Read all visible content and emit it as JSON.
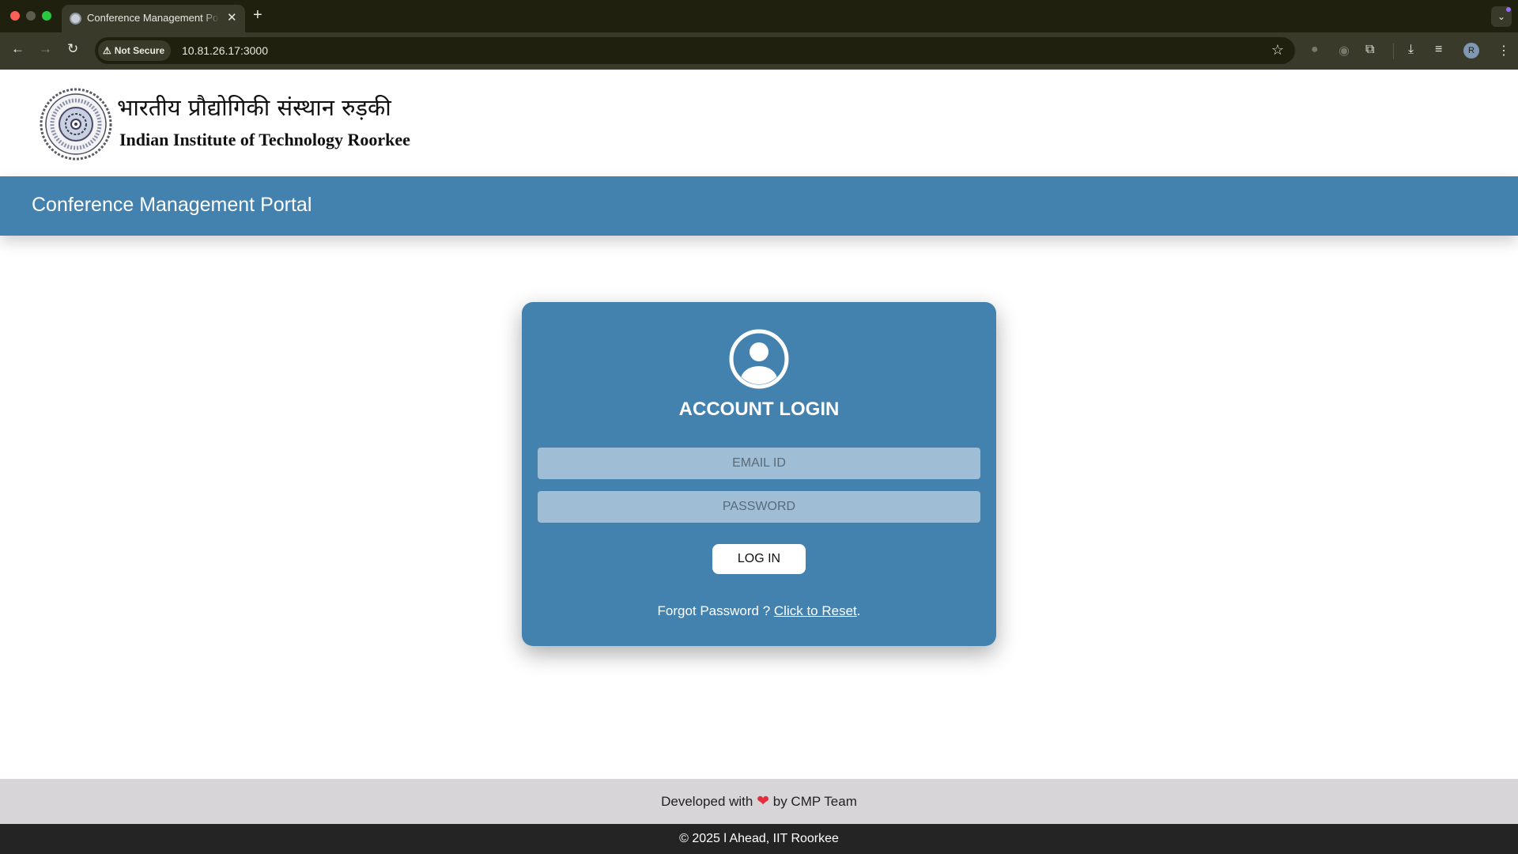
{
  "browser": {
    "tab_title": "Conference Management Portal",
    "tab_close": "✕",
    "new_tab": "+",
    "security_label": "Not Secure",
    "url": "10.81.26.17:3000",
    "profile_initial": "R"
  },
  "header": {
    "hindi_name": "भारतीय प्रौद्योगिकी संस्थान रुड़की",
    "english_name": "Indian Institute of Technology Roorkee"
  },
  "portal": {
    "title": "Conference Management Portal"
  },
  "login": {
    "heading": "ACCOUNT LOGIN",
    "email_placeholder": "EMAIL ID",
    "password_placeholder": "PASSWORD",
    "button_label": "LOG IN",
    "forgot_text": "Forgot Password ? ",
    "reset_link": "Click to Reset",
    "forgot_suffix": "."
  },
  "footer": {
    "dev_prefix": "Developed with ",
    "heart": "❤",
    "dev_suffix": " by CMP Team",
    "copyright": "© 2025 l Ahead, IIT Roorkee"
  },
  "colors": {
    "accent": "#4381ae",
    "footer_light": "#d7d5d7",
    "footer_dark": "#252425"
  }
}
